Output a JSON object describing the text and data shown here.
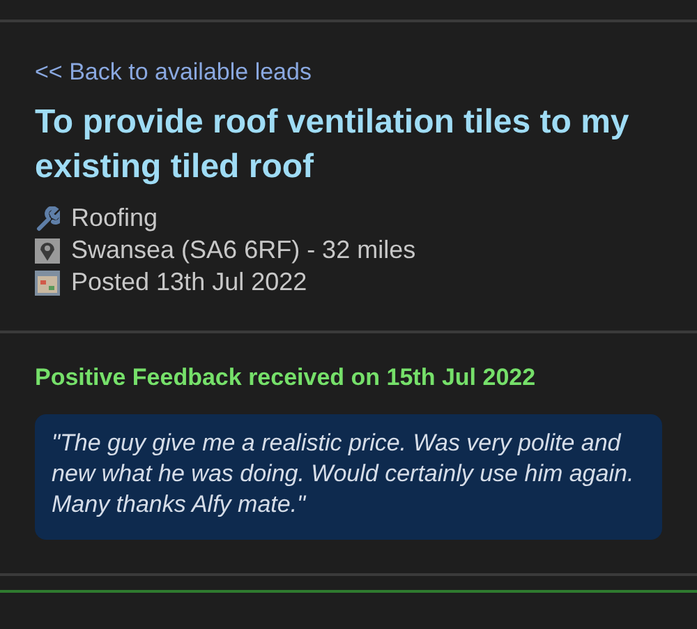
{
  "back_link": "<< Back to available leads",
  "title": "To provide roof ventilation tiles to my existing tiled roof",
  "details": [
    {
      "kind": "category",
      "text": "Roofing"
    },
    {
      "kind": "location",
      "text": "Swansea (SA6 6RF) - 32 miles"
    },
    {
      "kind": "date",
      "text": "Posted 13th Jul 2022"
    }
  ],
  "feedback": {
    "heading": "Positive Feedback received on 15th Jul 2022",
    "quote": "\"The guy give me a realistic price. Was very polite and new what he was doing. Would certainly use him again. Many thanks Alfy mate.\""
  }
}
